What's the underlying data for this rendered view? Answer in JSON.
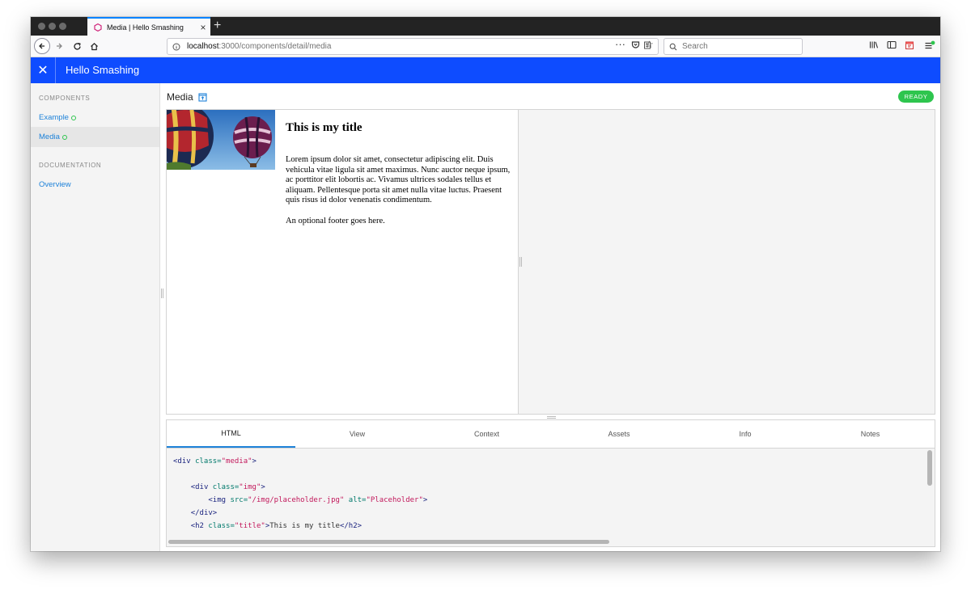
{
  "browser": {
    "tab_title": "Media | Hello Smashing",
    "new_tab": "+",
    "url_host": "localhost",
    "url_rest": ":3000/components/detail/media",
    "search_placeholder": "Search"
  },
  "app": {
    "title": "Hello Smashing",
    "close_glyph": "✕"
  },
  "sidebar": {
    "components_heading": "COMPONENTS",
    "components": [
      {
        "label": "Example"
      },
      {
        "label": "Media"
      }
    ],
    "documentation_heading": "DOCUMENTATION",
    "docs": [
      {
        "label": "Overview"
      }
    ]
  },
  "main": {
    "title": "Media",
    "status": "READY"
  },
  "preview": {
    "title": "This is my title",
    "body": "Lorem ipsum dolor sit amet, consectetur adipiscing elit. Duis vehicula vitae ligula sit amet maximus. Nunc auctor neque ipsum, ac porttitor elit lobortis ac. Vivamus ultrices sodales tellus et aliquam. Pellentesque porta sit amet nulla vitae luctus. Praesent quis risus id dolor venenatis condimentum.",
    "footer": "An optional footer goes here."
  },
  "panel": {
    "tabs": [
      {
        "label": "HTML"
      },
      {
        "label": "View"
      },
      {
        "label": "Context"
      },
      {
        "label": "Assets"
      },
      {
        "label": "Info"
      },
      {
        "label": "Notes"
      }
    ],
    "code": {
      "l1_tag": "<div ",
      "l1_attr": "class=",
      "l1_str": "\"media\"",
      "l1_end": ">",
      "l2_tag": "<div ",
      "l2_attr": "class=",
      "l2_str": "\"img\"",
      "l2_end": ">",
      "l3_tag": "<img ",
      "l3_attr1": "src=",
      "l3_str1": "\"/img/placeholder.jpg\"",
      "l3_attr2": " alt=",
      "l3_str2": "\"Placeholder\"",
      "l3_end": ">",
      "l4_tag": "</div>",
      "l5_tag": "<h2 ",
      "l5_attr": "class=",
      "l5_str": "\"title\"",
      "l5_mid": ">",
      "l5_text": "This is my title",
      "l5_end": "</h2>"
    }
  },
  "colors": {
    "appbar": "#0e4cff",
    "link": "#1e82d9",
    "ready": "#2ec54e"
  }
}
